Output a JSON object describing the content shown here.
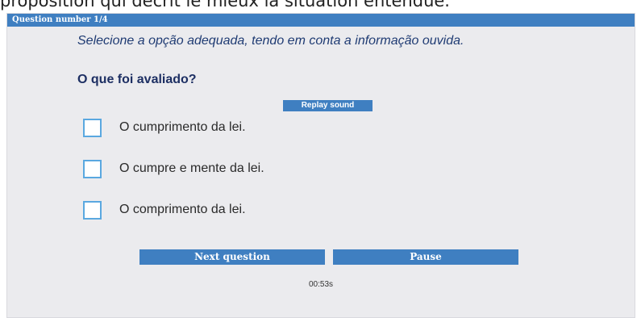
{
  "background_text": "proposition qui décrit le mieux la situation entendue.",
  "header": {
    "title": "Question number 1/4"
  },
  "instruction": "Selecione a opção adequada, tendo em conta a informação ouvida.",
  "question": "O que foi avaliado?",
  "replay_label": "Replay sound",
  "options": [
    {
      "label": "O cumprimento da lei."
    },
    {
      "label": "O cumpre e mente da lei."
    },
    {
      "label": "O comprimento da lei."
    }
  ],
  "buttons": {
    "next_label": "Next question",
    "pause_label": "Pause"
  },
  "timer": "00:53s",
  "colors": {
    "accent": "#3f7fc1",
    "checkbox_border": "#5aa8e0",
    "panel_bg": "#ebebee"
  }
}
